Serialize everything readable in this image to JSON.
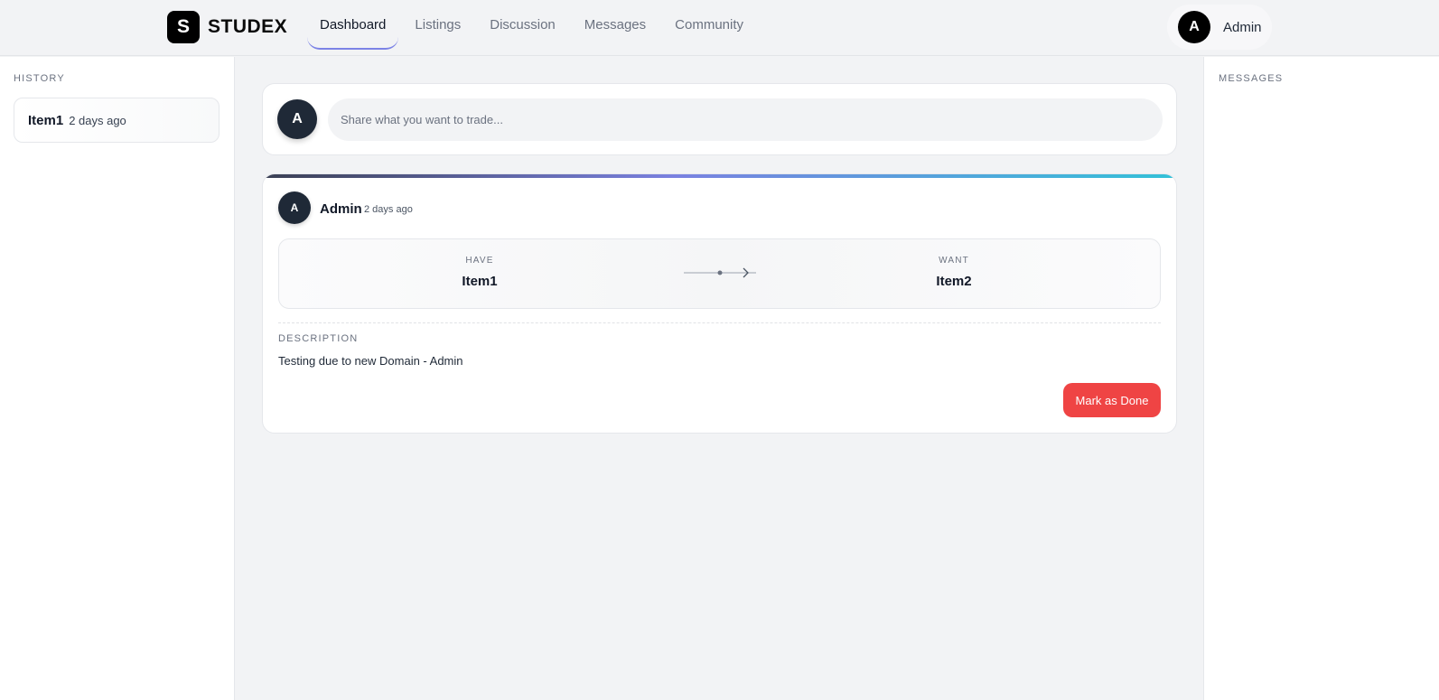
{
  "brand": {
    "logo_letter": "S",
    "name": "STUDEX"
  },
  "nav": {
    "items": [
      {
        "label": "Dashboard",
        "active": true
      },
      {
        "label": "Listings",
        "active": false
      },
      {
        "label": "Discussion",
        "active": false
      },
      {
        "label": "Messages",
        "active": false
      },
      {
        "label": "Community",
        "active": false
      }
    ]
  },
  "user": {
    "initial": "A",
    "name": "Admin"
  },
  "history": {
    "label": "HISTORY",
    "items": [
      {
        "title": "Item1",
        "time": "2 days ago"
      }
    ]
  },
  "messages": {
    "label": "MESSAGES"
  },
  "composer": {
    "avatar_initial": "A",
    "placeholder": "Share what you want to trade..."
  },
  "trade": {
    "avatar_initial": "A",
    "author": "Admin",
    "time": "2 days ago",
    "have_label": "HAVE",
    "have_value": "Item1",
    "want_label": "WANT",
    "want_value": "Item2",
    "description_label": "DESCRIPTION",
    "description": "Testing due to new Domain - Admin",
    "done_button": "Mark as Done"
  },
  "colors": {
    "accent": "#7c83e6",
    "danger": "#ef4444",
    "dark": "#1f2937",
    "bar_gradient": [
      "#3b4054",
      "#7a81e0",
      "#33c1d8"
    ]
  }
}
